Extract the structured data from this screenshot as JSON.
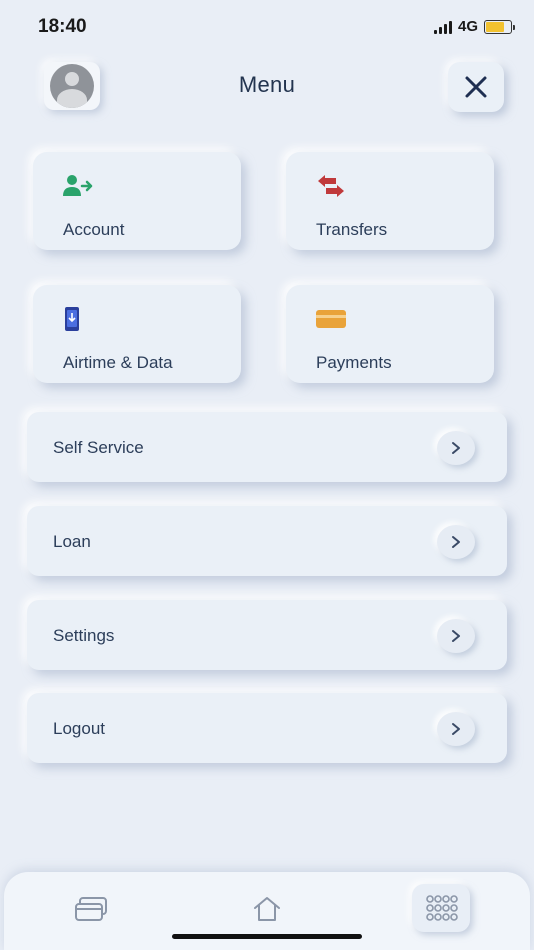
{
  "status": {
    "time": "18:40",
    "network": "4G",
    "battery_level": 0.75
  },
  "header": {
    "title": "Menu",
    "avatar_icon": "user-avatar-icon",
    "close_icon": "close-icon"
  },
  "tiles": [
    {
      "label": "Account",
      "icon": "user-transfer-icon",
      "color": "#2aa36b"
    },
    {
      "label": "Transfers",
      "icon": "swap-arrows-icon",
      "color": "#c0393b"
    },
    {
      "label": "Airtime & Data",
      "icon": "phone-icon",
      "color": "#3a55c4"
    },
    {
      "label": "Payments",
      "icon": "card-icon",
      "color": "#e9a33a"
    }
  ],
  "menu_rows": [
    {
      "label": "Self Service"
    },
    {
      "label": "Loan"
    },
    {
      "label": "Settings"
    },
    {
      "label": "Logout"
    }
  ],
  "bottom_nav": {
    "items": [
      "cards-icon",
      "home-icon",
      "grid-icon"
    ],
    "active": "grid-icon"
  }
}
